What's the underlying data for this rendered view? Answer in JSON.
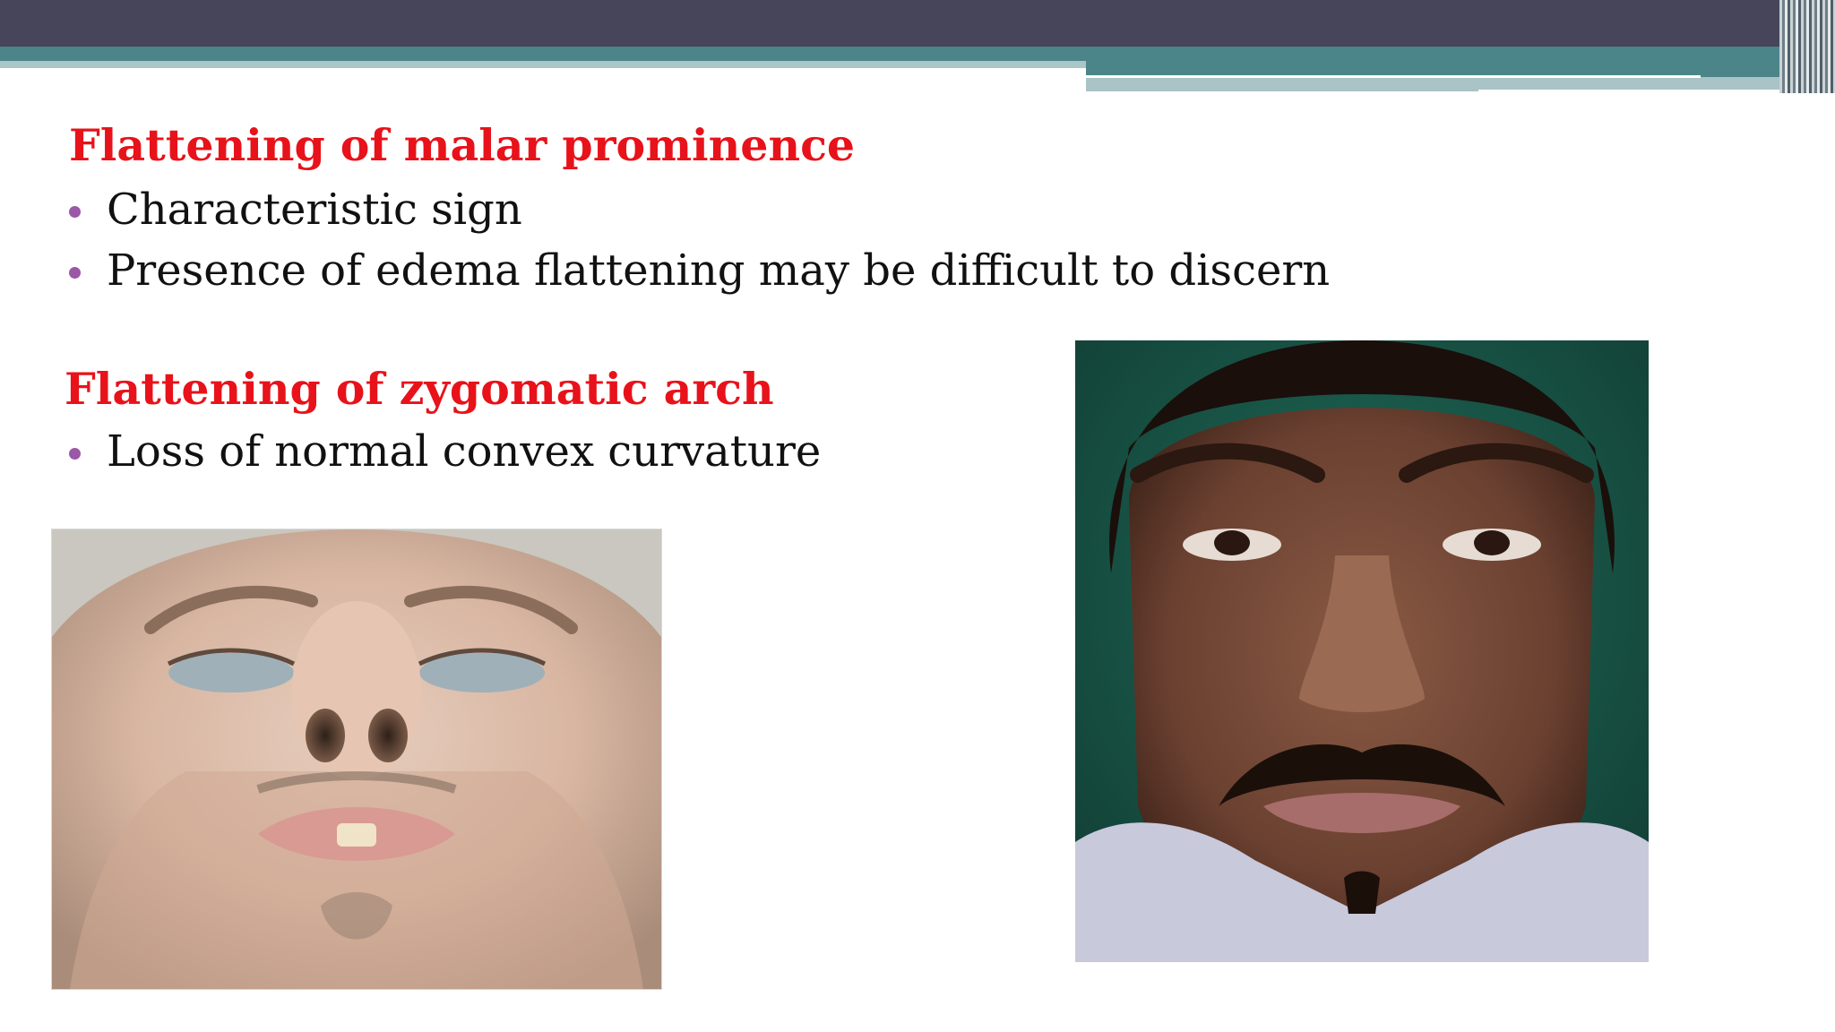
{
  "slide": {
    "section1": {
      "heading": "Flattening of malar prominence",
      "bullets": [
        "Characteristic sign",
        "Presence of edema flattening may be difficult to discern"
      ]
    },
    "section2": {
      "heading": "Flattening of zygomatic arch",
      "bullets": [
        "Loss of normal convex curvature"
      ]
    }
  },
  "colors": {
    "heading": "#e8121a",
    "bullet": "#9a58a6",
    "band_dark": "#464559",
    "band_teal": "#4b8489",
    "band_light": "#aac6c8"
  }
}
